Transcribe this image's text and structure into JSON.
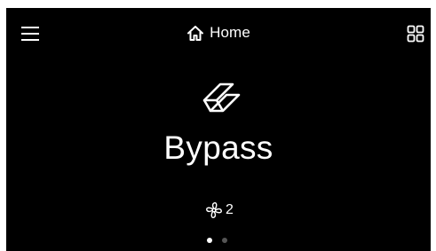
{
  "header": {
    "title": "Home",
    "menu_icon": "hamburger-menu-icon",
    "home_icon": "house-icon",
    "grid_icon": "grid-view-icon"
  },
  "mode": {
    "label": "Bypass",
    "icon": "bypass-icon"
  },
  "fan": {
    "icon": "fan-icon",
    "level": "2"
  },
  "pager": {
    "page_count": 2,
    "active_page": 1
  },
  "colors": {
    "background": "#000000",
    "foreground": "#ffffff",
    "inactive_dot": "#555555"
  }
}
